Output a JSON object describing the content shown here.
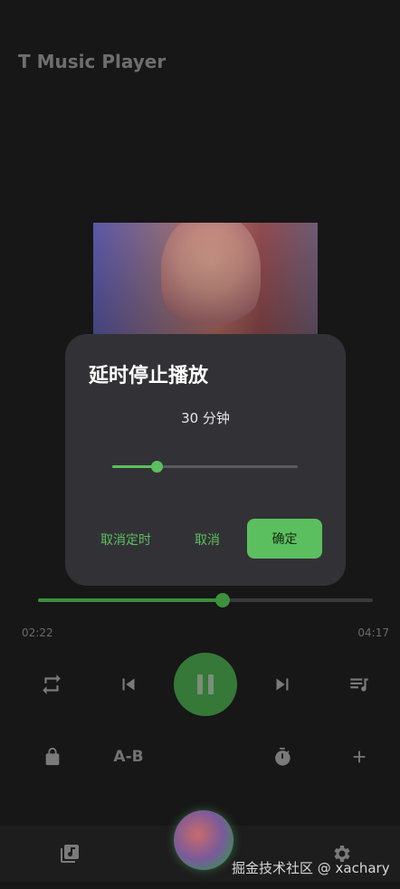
{
  "app": {
    "title": "T Music Player"
  },
  "player": {
    "elapsed": "02:22",
    "duration": "04:17",
    "progress_percent": 55.0,
    "ab_label": "A-B"
  },
  "dialog": {
    "title": "延时停止播放",
    "value_text": "30 分钟",
    "slider_percent": 24,
    "cancel_timer_label": "取消定时",
    "cancel_label": "取消",
    "confirm_label": "确定"
  },
  "watermark": "掘金技术社区 @ xachary",
  "colors": {
    "accent": "#5cbf5f",
    "dialog_bg": "#323236",
    "background": "#171717"
  },
  "icons": [
    "repeat-icon",
    "skip-previous-icon",
    "pause-icon",
    "skip-next-icon",
    "playlist-icon",
    "lock-icon",
    "timer-icon",
    "add-icon",
    "library-icon",
    "settings-icon"
  ]
}
